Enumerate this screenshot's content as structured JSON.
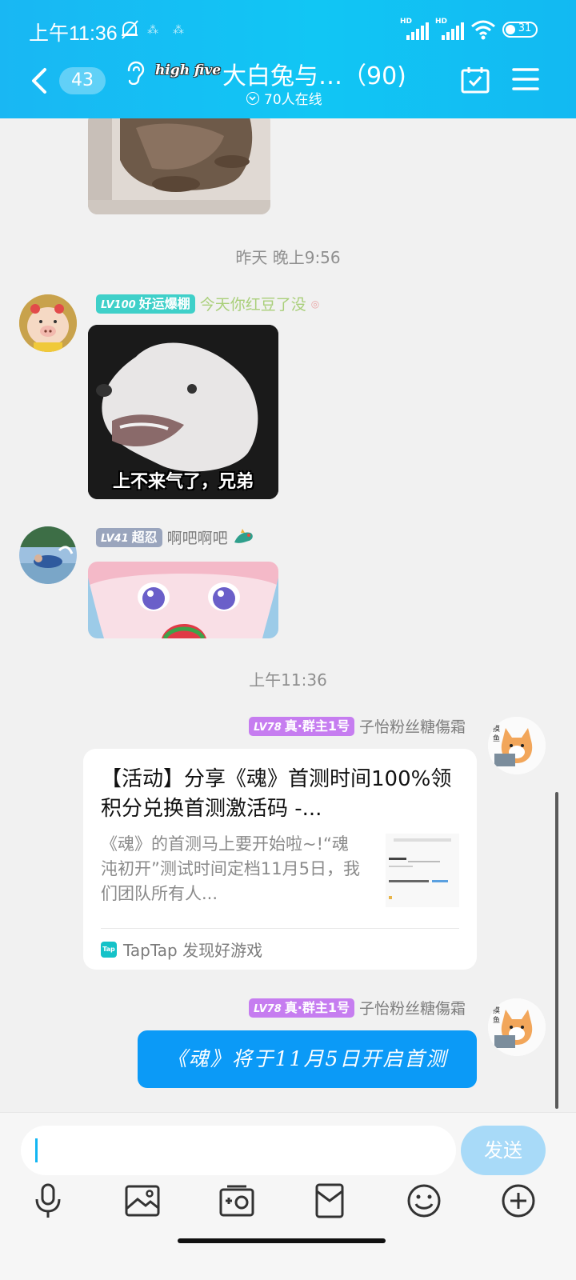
{
  "status_bar": {
    "time": "上午11:36",
    "battery": "31",
    "sim1_label": "HD",
    "sim2_label": "HD"
  },
  "header": {
    "back_count": "43",
    "title": "大白兔与…（90)",
    "logo_text": "high five",
    "online": "70人在线"
  },
  "timestamps": {
    "t1": "昨天 晚上9:56",
    "t2": "上午11:36"
  },
  "messages": [
    {
      "level": "LV100",
      "tag": "好运爆棚",
      "nickname": "今天你红豆了没",
      "image_caption": "上不来气了，兄弟"
    },
    {
      "level": "LV41",
      "tag": "超忍",
      "nickname": "啊吧啊吧"
    },
    {
      "level": "LV78",
      "tag": "真·群主1号",
      "nickname": "子怡粉丝糖傷霜",
      "card": {
        "title": "【活动】分享《魂》首测时间100%领积分兑换首测激活码 -...",
        "desc": "《魂》的首测马上要开始啦~!“魂沌初开”测试时间定档11月5日，我们团队所有人...",
        "source_icon": "Tap",
        "source": "TapTap 发现好游戏"
      }
    },
    {
      "level": "LV78",
      "tag": "真·群主1号",
      "nickname": "子怡粉丝糖傷霜",
      "text": "《魂》将于11月5日开启首测"
    }
  ],
  "input": {
    "placeholder": "",
    "send_label": "发送"
  },
  "colors": {
    "header": "#13bdf3",
    "lv100": "#3fd0c9",
    "lv41": "#9aa5bd",
    "lv78": "#c67df0",
    "bubble": "#0b9af7"
  },
  "toolbar": [
    "microphone-icon",
    "image-icon",
    "camera-icon",
    "red-packet-icon",
    "emoji-icon",
    "plus-icon"
  ]
}
